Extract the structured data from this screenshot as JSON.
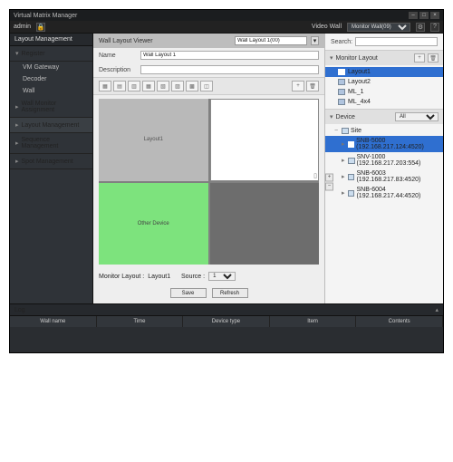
{
  "app_title": "Virtual Matrix Manager",
  "user": "admin",
  "video_wall_label": "Video Wall",
  "video_wall_value": "Monitor Wall(09)",
  "sidebar": {
    "header": "Layout Management",
    "register": "Register",
    "register_items": [
      "VM Gateway",
      "Decoder",
      "Wall"
    ],
    "assign": "Wall Monitor Assignment",
    "layout": "Layout Management",
    "sequence": "Sequence Management",
    "spot": "Spot Management"
  },
  "center": {
    "title": "Wall Layout Viewer",
    "dropdown": "Wall Layout 1(00)",
    "name_label": "Name",
    "name_value": "Wall Layout 1",
    "desc_label": "Description",
    "desc_value": "",
    "cell1": "Layout1",
    "cell3": "Other Device",
    "mon_layout_lbl": "Monitor Layout :",
    "mon_layout_val": "Layout1",
    "source_lbl": "Source :",
    "source_val": "1",
    "save": "Save",
    "refresh": "Refresh"
  },
  "right": {
    "search_lbl": "Search:",
    "ml_header": "Monitor Layout",
    "ml_items": [
      "Layout1",
      "Layout2",
      "ML_1",
      "ML_4x4"
    ],
    "dev_header": "Device",
    "dev_filter": "All",
    "site": "Site",
    "devices": [
      "SNB-5000 (192.168.217.124:4520)",
      "SNV-1000 (192.168.217.203:554)",
      "SNB-6003 (192.168.217.83:4520)",
      "SNB-6004 (192.168.217.44:4520)"
    ]
  },
  "log": {
    "title": "Log",
    "cols": [
      "Wall name",
      "Time",
      "Device type",
      "Item",
      "Contents"
    ]
  }
}
